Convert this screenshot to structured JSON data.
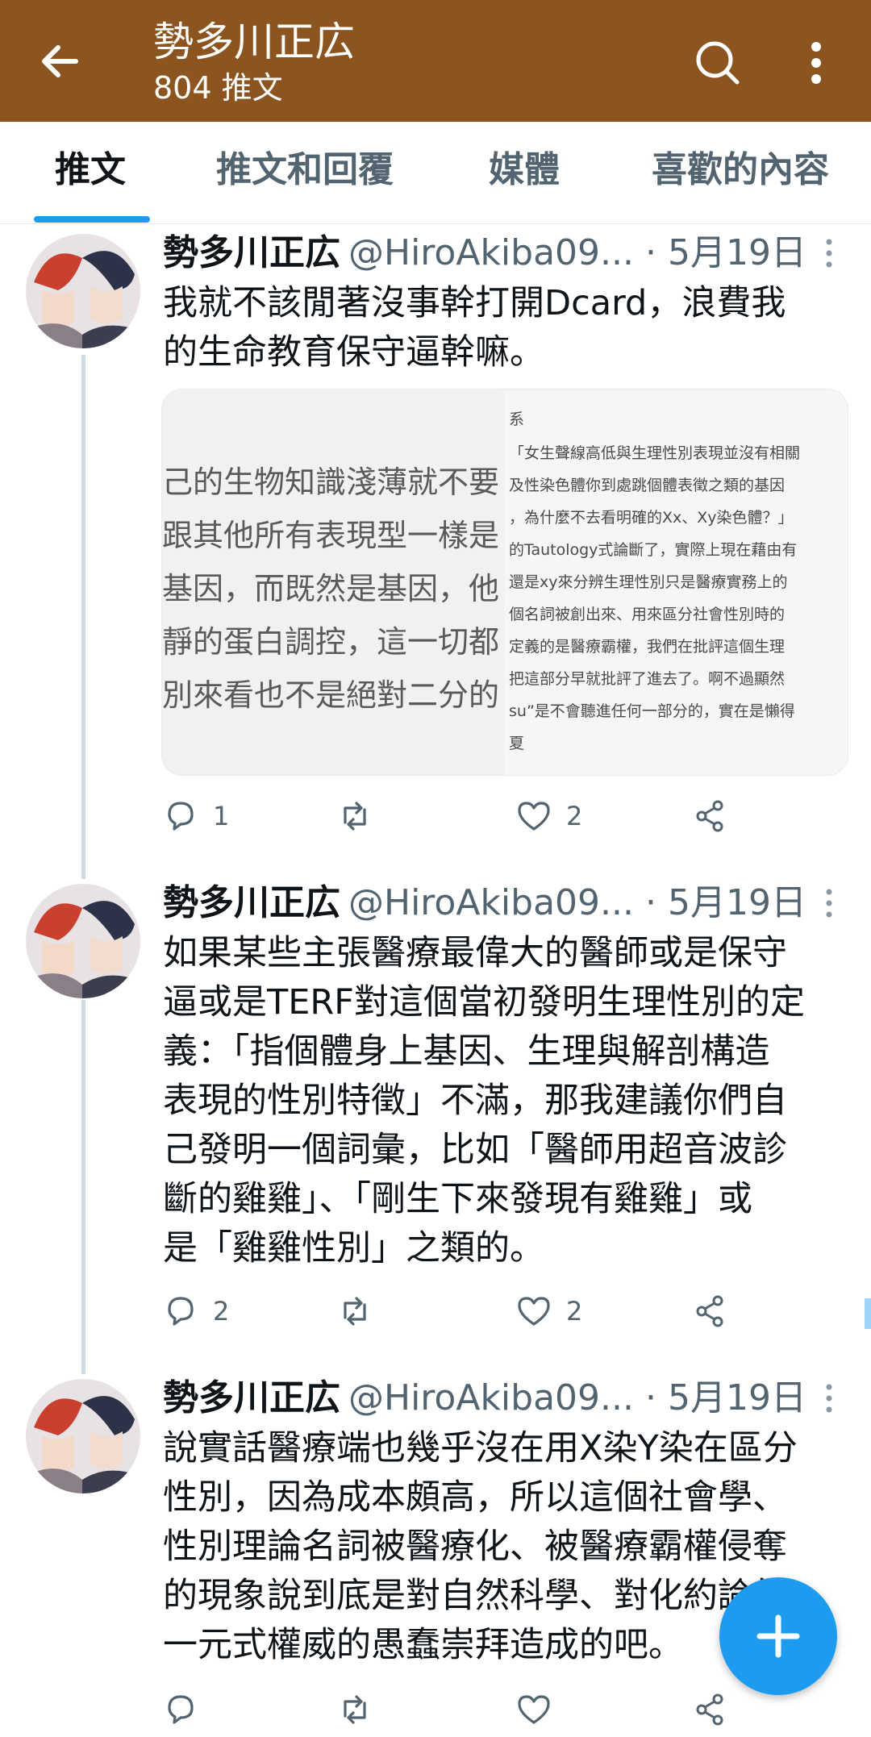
{
  "header": {
    "title": "勢多川正広",
    "subtitle": "804 推文",
    "background_color": "#8c5520",
    "icons": [
      "back-arrow-icon",
      "search-icon",
      "more-vertical-icon"
    ]
  },
  "tabs": [
    {
      "label": "推文",
      "active": true
    },
    {
      "label": "推文和回覆",
      "active": false
    },
    {
      "label": "媒體",
      "active": false
    },
    {
      "label": "喜歡的內容",
      "active": false
    }
  ],
  "accent_color": "#1d9bf0",
  "tweets": [
    {
      "name": "勢多川正広",
      "handle": "@HiroAkiba09...",
      "date": "· 5月19日",
      "lines": [
        "我就不該閒著沒事幹打開Dcard，浪費我",
        "的生命教育保守逼幹嘛。"
      ],
      "media": {
        "left_lines": [
          "己的生物知識淺薄就不要",
          "跟其他所有表現型一樣是",
          "基因，而既然是基因，他",
          "靜的蛋白調控，這一切都會",
          "別來看也不是絕對二分的"
        ],
        "right_lines": [
          "系",
          "「女生聲線高低與生理性別表現並沒有相關",
          "及性染色體你到處跳個體表徵之類的基因",
          "，為什麼不去看明確的Xx、Xy染色體？」",
          "的Tautology式論斷了，實際上現在藉由有",
          "還是xy來分辨生理性別只是醫療實務上的",
          "個名詞被創出來、用來區分社會性別時的",
          "定義的是醫療霸權，我們在批評這個生理",
          "把這部分早就批評了進去了。啊不過顯然",
          "su”是不會聽進任何一部分的，實在是懶得",
          "夏"
        ]
      },
      "replies": "1",
      "retweets": "",
      "likes": "2"
    },
    {
      "name": "勢多川正広",
      "handle": "@HiroAkiba09...",
      "date": "· 5月19日",
      "lines": [
        "如果某些主張醫療最偉大的醫師或是保守",
        "逼或是TERF對這個當初發明生理性別的定",
        "義：「指個體身上基因、生理與解剖構造",
        "表現的性別特徵」不滿，那我建議你們自",
        "己發明一個詞彙，比如「醫師用超音波診",
        "斷的雞雞」、「剛生下來發現有雞雞」或",
        "是「雞雞性別」之類的。"
      ],
      "replies": "2",
      "retweets": "",
      "likes": "2"
    },
    {
      "name": "勢多川正広",
      "handle": "@HiroAkiba09...",
      "date": "· 5月19日",
      "lines": [
        "說實話醫療端也幾乎沒在用X染Y染在區分",
        "性別，因為成本頗高，所以這個社會學、",
        "性別理論名詞被醫療化、被醫療霸權侵奪",
        "的現象說到底是對自然科學、對化約論的",
        "一元式權威的愚蠢崇拜造成的吧。"
      ],
      "replies": "",
      "retweets": "",
      "likes": ""
    }
  ],
  "fab": {
    "icon": "plus-icon"
  }
}
